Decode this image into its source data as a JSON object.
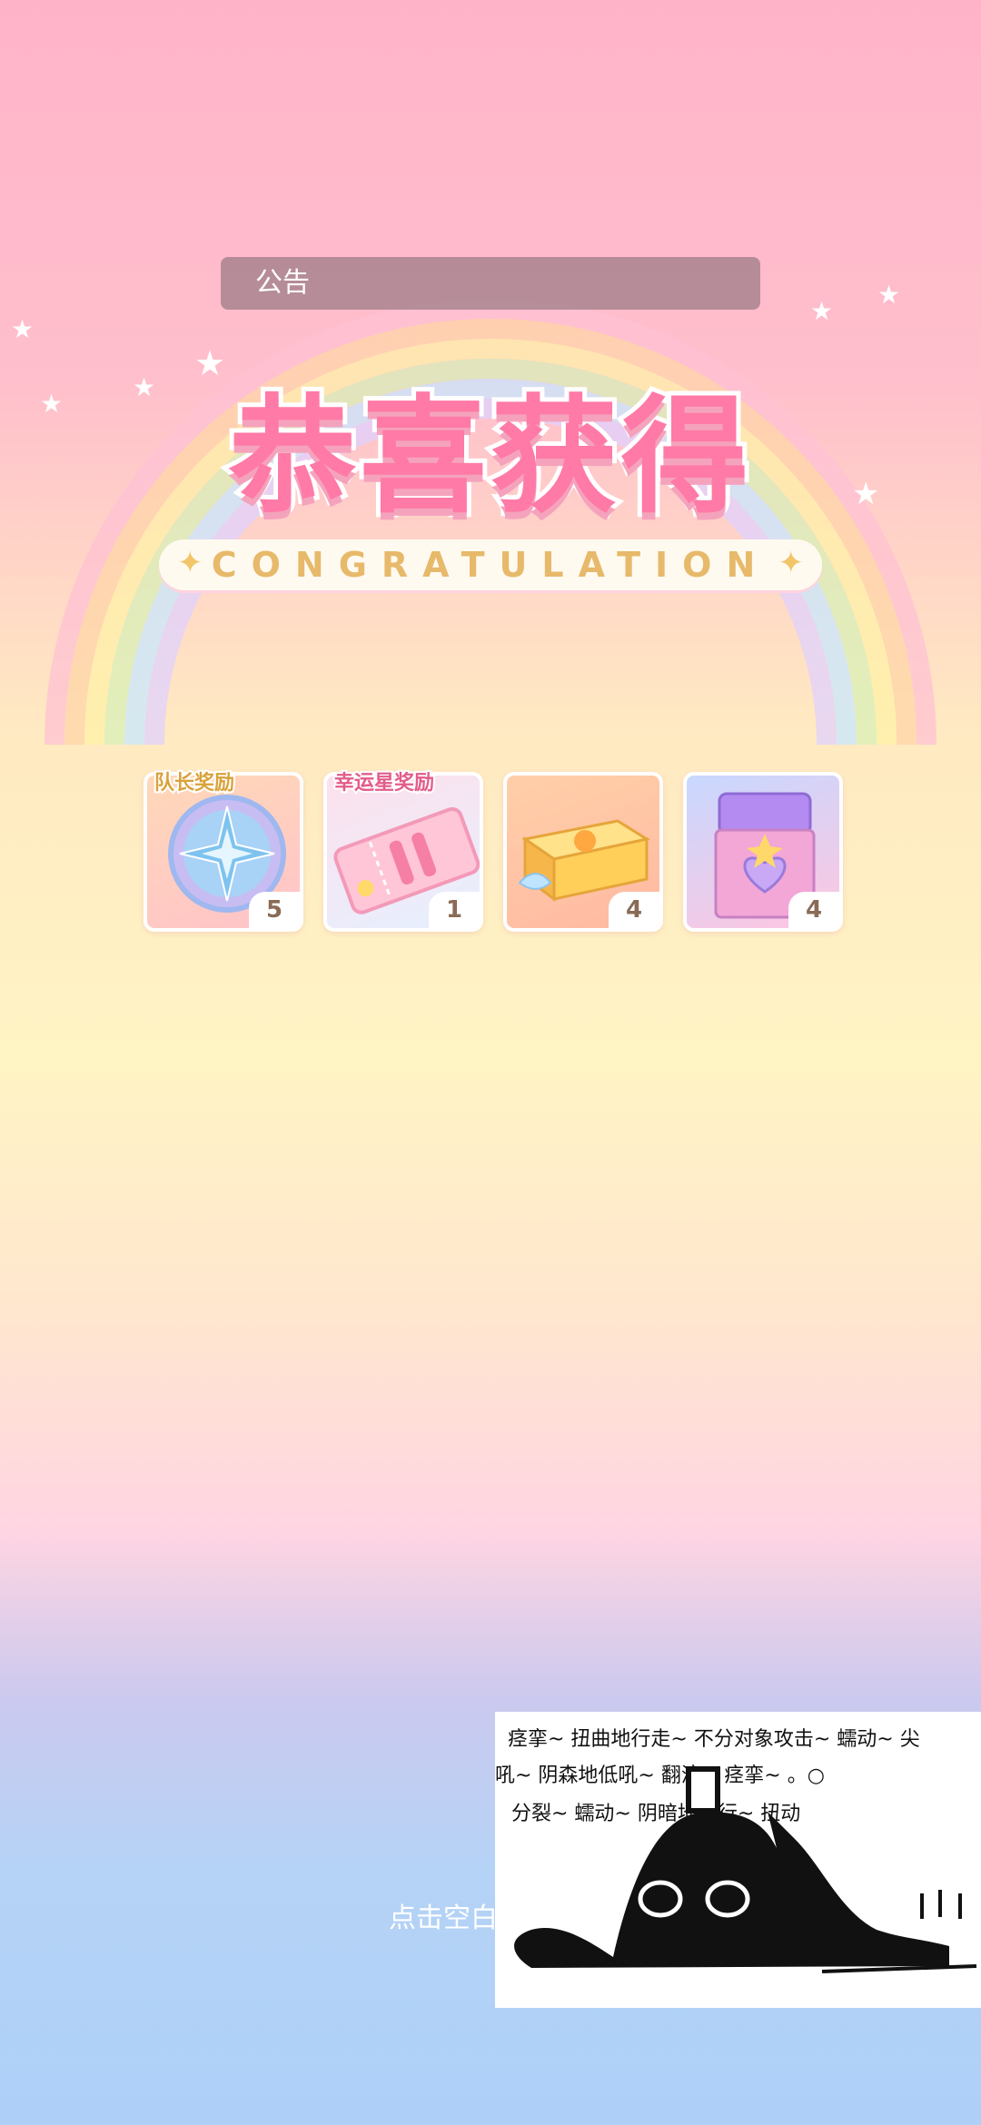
{
  "notice": {
    "label": "公告"
  },
  "banner": {
    "title": "恭喜获得",
    "subtitle": "CONGRATULATION"
  },
  "rewards": [
    {
      "tag": "队长奖励",
      "tag_color": "#d9a23a",
      "icon": "compass-star-medal-icon",
      "count": "5"
    },
    {
      "tag": "幸运星奖励",
      "tag_color": "#e35c8a",
      "icon": "ticket-coupon-icon",
      "count": "1"
    },
    {
      "tag": "",
      "tag_color": "",
      "icon": "gift-box-icon",
      "count": "4"
    },
    {
      "tag": "",
      "tag_color": "",
      "icon": "heart-pouch-icon",
      "count": "4"
    }
  ],
  "hint": "点击空白",
  "comic": {
    "lines": [
      "痉挛~  扭曲地行走~  不分对象攻击~  蠕动~  尖",
      "吼~  阴森地低吼~                    翻滚~  痉挛~  。○",
      "分裂~  蠕动~                        阴暗地爬行~  扭动"
    ]
  },
  "colors": {
    "title_pink": "#ff7aa6",
    "subtitle_gold": "#e7b96a"
  }
}
